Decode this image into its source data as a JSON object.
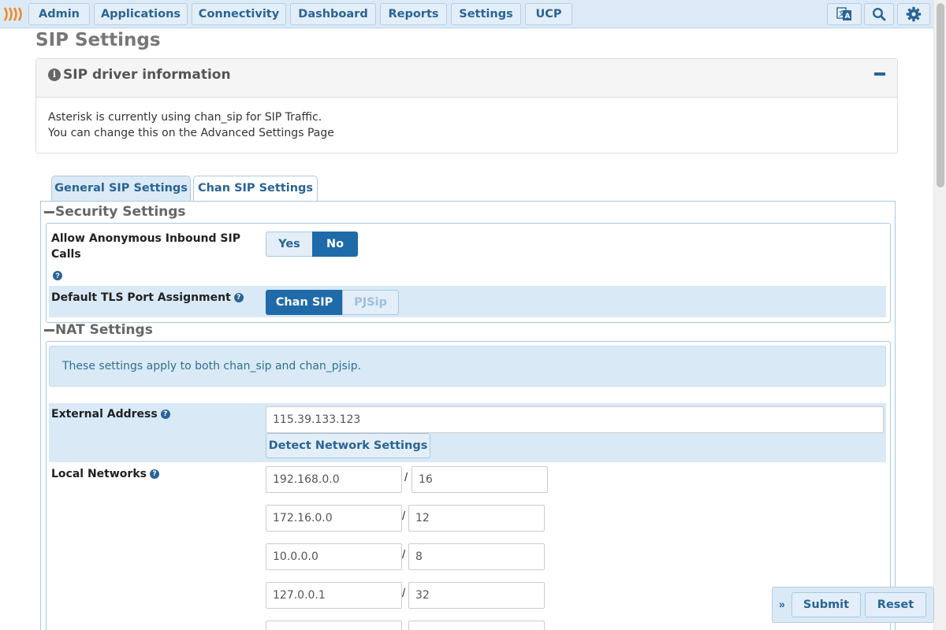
{
  "nav": {
    "items": [
      "Admin",
      "Applications",
      "Connectivity",
      "Dashboard",
      "Reports",
      "Settings",
      "UCP"
    ],
    "icons": [
      "translate-icon",
      "search-icon",
      "gear-icon"
    ],
    "accent": "#2a6496",
    "bar_color": "#dbeaf6"
  },
  "page": {
    "title": "SIP Settings"
  },
  "info_panel": {
    "title": "SIP driver information",
    "line1": "Asterisk is currently using chan_sip for SIP Traffic.",
    "line2": "You can change this on the Advanced Settings Page"
  },
  "tabs": [
    {
      "label": "General SIP Settings",
      "active": true
    },
    {
      "label": "Chan SIP Settings",
      "active": false
    }
  ],
  "security": {
    "title": "Security Settings",
    "anon_label_1": "Allow Anonymous Inbound SIP",
    "anon_label_2": "Calls",
    "anon_yes": "Yes",
    "anon_no": "No",
    "anon_selected": "No",
    "tls_label": "Default TLS Port Assignment",
    "tls_chansip": "Chan SIP",
    "tls_pjsip": "PJSip",
    "tls_selected": "Chan SIP"
  },
  "nat": {
    "title": "NAT Settings",
    "note": "These settings apply to both chan_sip and chan_pjsip.",
    "external_label": "External Address",
    "external_value": "115.39.133.123",
    "detect_button": "Detect Network Settings",
    "local_label": "Local Networks",
    "networks": [
      {
        "ip": "192.168.0.0",
        "mask": "16"
      },
      {
        "ip": "172.16.0.0",
        "mask": "12"
      },
      {
        "ip": "10.0.0.0",
        "mask": "8"
      },
      {
        "ip": "127.0.0.1",
        "mask": "32"
      }
    ]
  },
  "actions": {
    "submit": "Submit",
    "reset": "Reset"
  }
}
